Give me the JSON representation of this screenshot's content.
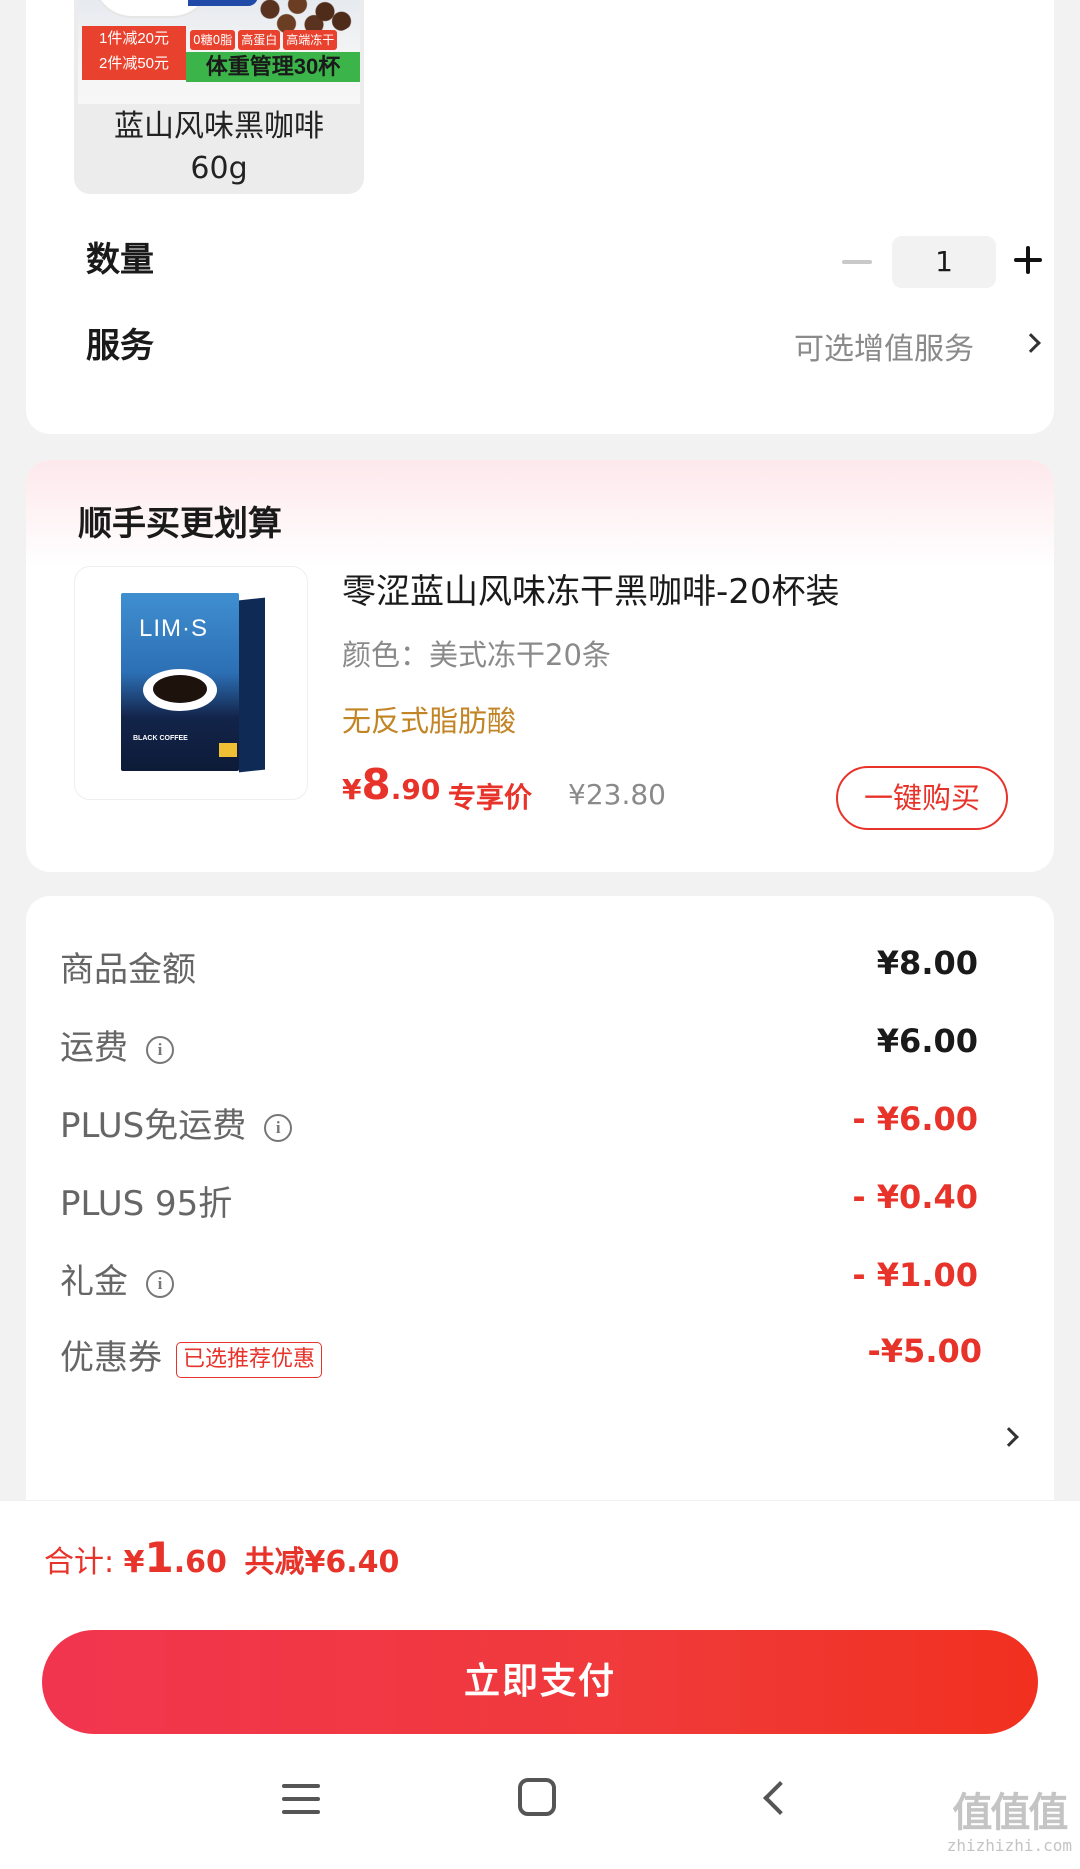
{
  "product": {
    "sku_name_line1": "蓝山风味黑咖啡",
    "sku_name_line2": "60g",
    "promo_line1": "1件减20元",
    "promo_line2": "2件减50元",
    "tags": [
      "0糖0脂",
      "高蛋白",
      "高端冻干"
    ],
    "banner": "体重管理30杯"
  },
  "quantity": {
    "label": "数量",
    "value": "1"
  },
  "service": {
    "label": "服务",
    "value": "可选增值服务"
  },
  "recommend": {
    "title": "顺手买更划算",
    "image_logo": "LIM·S",
    "image_label": "BLACK COFFEE",
    "name": "零涩蓝山风味冻干黑咖啡-20杯装",
    "spec": "颜色：美式冻干20条",
    "tag": "无反式脂肪酸",
    "price_yen": "¥",
    "price_int": "8",
    "price_dec": ".90",
    "exclusive": "专享价",
    "original": "¥23.80",
    "buy_label": "一键购买"
  },
  "summary": {
    "rows": [
      {
        "label": "商品金额",
        "value": "¥8.00",
        "info": false,
        "negative": false
      },
      {
        "label": "运费",
        "value": "¥6.00",
        "info": true,
        "negative": false
      },
      {
        "label": "PLUS免运费",
        "value": "- ¥6.00",
        "info": true,
        "negative": true
      },
      {
        "label": "PLUS 95折",
        "value": "- ¥0.40",
        "info": false,
        "negative": true
      },
      {
        "label": "礼金",
        "value": "- ¥1.00",
        "info": true,
        "negative": true
      }
    ],
    "coupon_label": "优惠券",
    "coupon_tag": "已选推荐优惠",
    "coupon_value": "-¥5.00"
  },
  "total": {
    "prefix": "合计: ",
    "yen": "¥",
    "amount_int": "1",
    "amount_dec": ".60",
    "saved": "共减¥6.40"
  },
  "pay_button": "立即支付",
  "watermark": {
    "big": "值值值",
    "small": "zhizhizhi.com"
  },
  "colors": {
    "accent": "#e8332a",
    "tag_gold": "#c28526",
    "bg": "#f2f2f2"
  },
  "icons": [
    "info-icon",
    "chevron-right-icon",
    "minus-icon",
    "plus-icon",
    "menu-icon",
    "home-icon",
    "back-icon"
  ]
}
